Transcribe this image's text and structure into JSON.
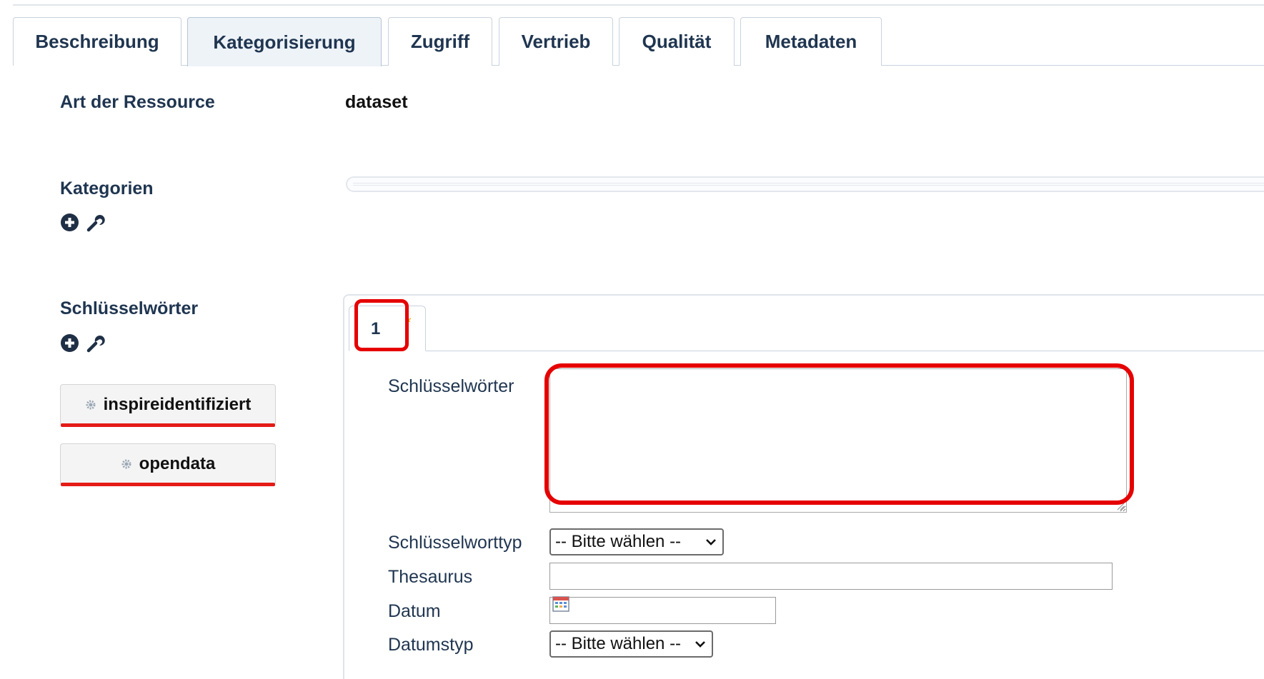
{
  "tabs": [
    {
      "label": "Beschreibung",
      "active": false
    },
    {
      "label": "Kategorisierung",
      "active": true
    },
    {
      "label": "Zugriff",
      "active": false
    },
    {
      "label": "Vertrieb",
      "active": false
    },
    {
      "label": "Qualität",
      "active": false
    },
    {
      "label": "Metadaten",
      "active": false
    }
  ],
  "resource": {
    "label": "Art der Ressource",
    "value": "dataset"
  },
  "categories": {
    "label": "Kategorien",
    "add_icon": "plus-circle-icon",
    "edit_icon": "wrench-icon"
  },
  "keywords": {
    "label": "Schlüsselwörter",
    "add_icon": "plus-circle-icon",
    "edit_icon": "wrench-icon",
    "buttons": [
      {
        "label": "inspireidentifiziert",
        "icon": "gear-icon"
      },
      {
        "label": "opendata",
        "icon": "gear-icon"
      }
    ]
  },
  "keyword_panel": {
    "subtab_label": "1",
    "required_marker": "*",
    "fields": {
      "keywords_label": "Schlüsselwörter",
      "keywords_value": "",
      "keyword_type_label": "Schlüsselworttyp",
      "keyword_type_value": "-- Bitte wählen --",
      "thesaurus_label": "Thesaurus",
      "thesaurus_value": "",
      "date_label": "Datum",
      "date_value": "",
      "date_type_label": "Datumstyp",
      "date_type_value": "-- Bitte wählen --"
    }
  },
  "colors": {
    "highlight": "#e60000",
    "text": "#1f3550",
    "accent_star": "#f0a400"
  }
}
